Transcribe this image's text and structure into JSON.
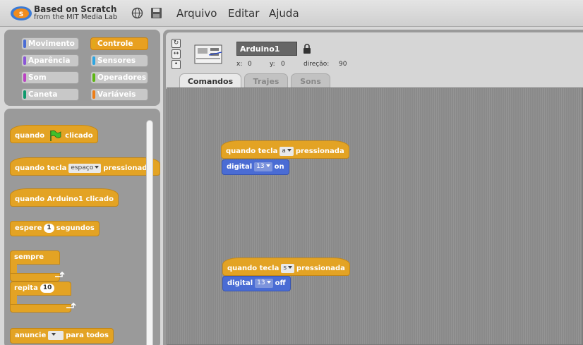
{
  "app": {
    "logo_title": "Based on Scratch",
    "logo_subtitle": "from the MIT Media Lab"
  },
  "menu": [
    "Arquivo",
    "Editar",
    "Ajuda"
  ],
  "icons": {
    "logo": "scratch-logo-icon",
    "globe": "globe-icon",
    "save": "save-icon",
    "lock": "lock-icon"
  },
  "categories": [
    {
      "label": "Movimento",
      "color": "#4a6cd4",
      "selected": false
    },
    {
      "label": "Controle",
      "color": "#e1a91a",
      "selected": true
    },
    {
      "label": "Aparência",
      "color": "#8a55d7",
      "selected": false
    },
    {
      "label": "Sensores",
      "color": "#2ca5e2",
      "selected": false
    },
    {
      "label": "Som",
      "color": "#bb42c3",
      "selected": false
    },
    {
      "label": "Operadores",
      "color": "#5cb712",
      "selected": false
    },
    {
      "label": "Caneta",
      "color": "#0e9a6c",
      "selected": false
    },
    {
      "label": "Variáveis",
      "color": "#ee7d16",
      "selected": false
    }
  ],
  "palette_blocks": {
    "when_flag_pre": "quando",
    "when_flag_post": "clicado",
    "when_key_pre": "quando tecla",
    "when_key_dd": "espaço",
    "when_key_post": "pressionada",
    "when_sprite": "quando Arduino1 clicado",
    "wait_pre": "espere",
    "wait_value": "1",
    "wait_post": "segundos",
    "forever": "sempre",
    "repeat_pre": "repita",
    "repeat_value": "10",
    "broadcast_pre": "anuncie",
    "broadcast_post": "para todos"
  },
  "sprite": {
    "name": "Arduino1",
    "x_label": "x:",
    "x_value": "0",
    "y_label": "y:",
    "y_value": "0",
    "dir_label": "direção:",
    "dir_value": "90"
  },
  "tabs": [
    "Comandos",
    "Trajes",
    "Sons"
  ],
  "scripts": [
    {
      "hat_pre": "quando tecla",
      "key": "a",
      "hat_post": "pressionada",
      "cmd": "digital",
      "pin": "13",
      "state": "on"
    },
    {
      "hat_pre": "quando tecla",
      "key": "s",
      "hat_post": "pressionada",
      "cmd": "digital",
      "pin": "13",
      "state": "off"
    }
  ]
}
